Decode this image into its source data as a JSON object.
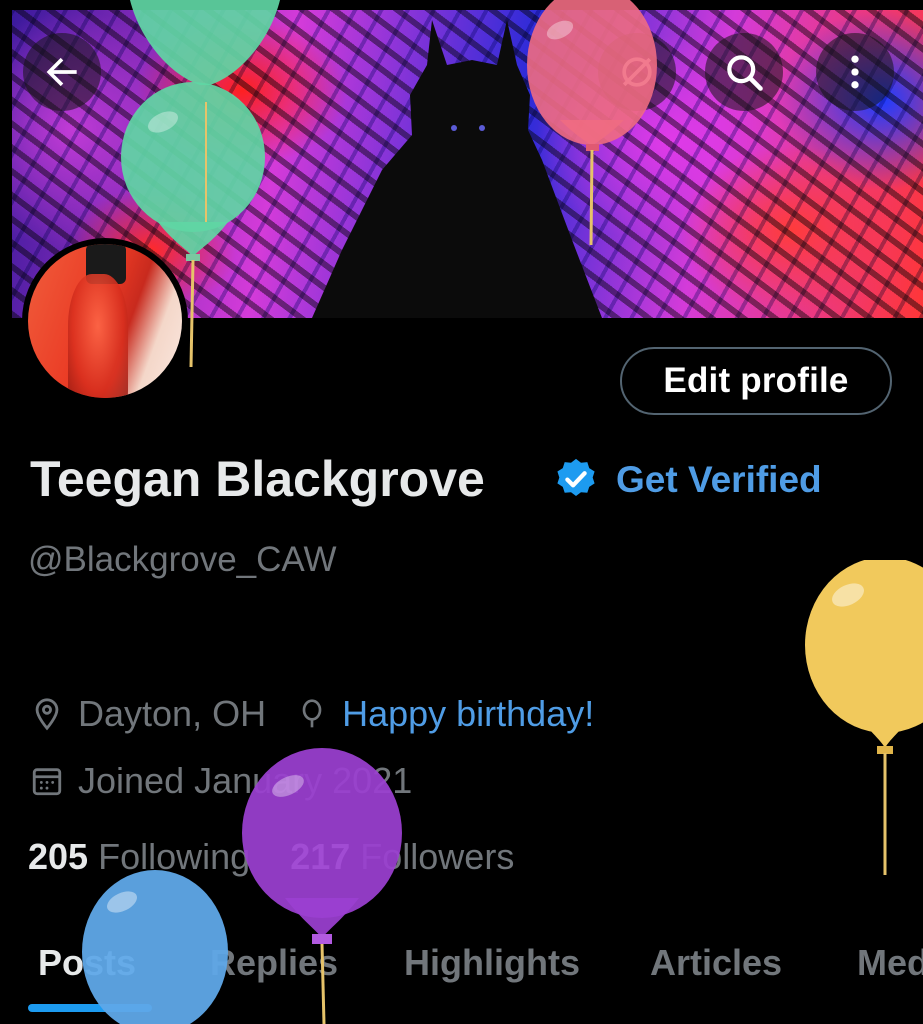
{
  "profile": {
    "name": "Teegan Blackgrove",
    "get_verified": "Get Verified",
    "handle": "@Blackgrove_CAW",
    "location": "Dayton, OH",
    "birthday": "Happy birthday!",
    "joined": "Joined January 2021",
    "following_count": "205",
    "following_label": "Following",
    "followers_count": "217",
    "followers_label": "Followers"
  },
  "header": {
    "edit_profile": "Edit profile"
  },
  "tabs": [
    {
      "label": "Posts",
      "active": true
    },
    {
      "label": "Replies",
      "active": false
    },
    {
      "label": "Highlights",
      "active": false
    },
    {
      "label": "Articles",
      "active": false
    },
    {
      "label": "Media",
      "active": false
    }
  ],
  "icons": {
    "back": "back-arrow-icon",
    "grok": "grok-icon",
    "search": "search-icon",
    "more": "more-vertical-icon",
    "verified": "verified-badge-icon",
    "location": "location-pin-icon",
    "birthday": "balloon-icon",
    "calendar": "calendar-icon"
  },
  "colors": {
    "accent": "#1d9bf0",
    "link": "#4f9ce5",
    "muted": "#71767b",
    "text": "#e7e9ea",
    "balloon_green": "#5fd6a4",
    "balloon_pink": "#ef6b82",
    "balloon_yellow": "#f1c95c",
    "balloon_purple": "#9b3fd1",
    "balloon_blue": "#5fa8e8"
  }
}
